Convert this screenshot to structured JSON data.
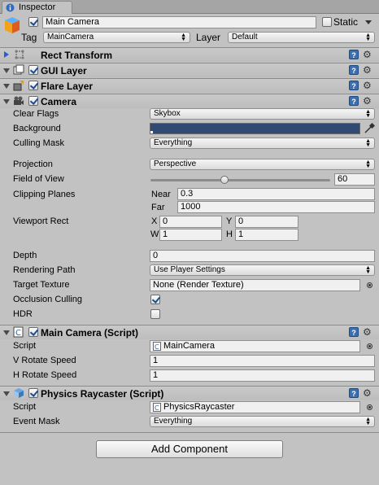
{
  "window": {
    "tab_title": "Inspector",
    "accent": "#3b6fb0"
  },
  "header": {
    "object_name": "Main Camera",
    "static_label": "Static",
    "tag_label": "Tag",
    "tag_value": "MainCamera",
    "layer_label": "Layer",
    "layer_value": "Default"
  },
  "components": {
    "rect_transform": {
      "title": "Rect Transform"
    },
    "gui_layer": {
      "title": "GUI Layer"
    },
    "flare_layer": {
      "title": "Flare Layer"
    },
    "camera": {
      "title": "Camera",
      "clear_flags_label": "Clear Flags",
      "clear_flags_value": "Skybox",
      "background_label": "Background",
      "background_color": "#304a73",
      "culling_mask_label": "Culling Mask",
      "culling_mask_value": "Everything",
      "projection_label": "Projection",
      "projection_value": "Perspective",
      "fov_label": "Field of View",
      "fov_value": "60",
      "fov_slider_fraction": 0.41,
      "clipping_label": "Clipping Planes",
      "near_label": "Near",
      "near_value": "0.3",
      "far_label": "Far",
      "far_value": "1000",
      "viewport_label": "Viewport Rect",
      "x_label": "X",
      "x_value": "0",
      "y_label": "Y",
      "y_value": "0",
      "w_label": "W",
      "w_value": "1",
      "h_label": "H",
      "h_value": "1",
      "depth_label": "Depth",
      "depth_value": "0",
      "rendering_path_label": "Rendering Path",
      "rendering_path_value": "Use Player Settings",
      "target_texture_label": "Target Texture",
      "target_texture_value": "None (Render Texture)",
      "occlusion_label": "Occlusion Culling",
      "hdr_label": "HDR"
    },
    "main_camera_script": {
      "title": "Main Camera (Script)",
      "script_label": "Script",
      "script_value": "MainCamera",
      "v_rotate_label": "V Rotate Speed",
      "v_rotate_value": "1",
      "h_rotate_label": "H Rotate Speed",
      "h_rotate_value": "1"
    },
    "physics_raycaster": {
      "title": "Physics Raycaster (Script)",
      "script_label": "Script",
      "script_value": "PhysicsRaycaster",
      "event_mask_label": "Event Mask",
      "event_mask_value": "Everything"
    }
  },
  "add_component_label": "Add Component",
  "icons": {
    "help": "?",
    "gear": "⚙",
    "eyedropper": "eyedropper-icon"
  }
}
